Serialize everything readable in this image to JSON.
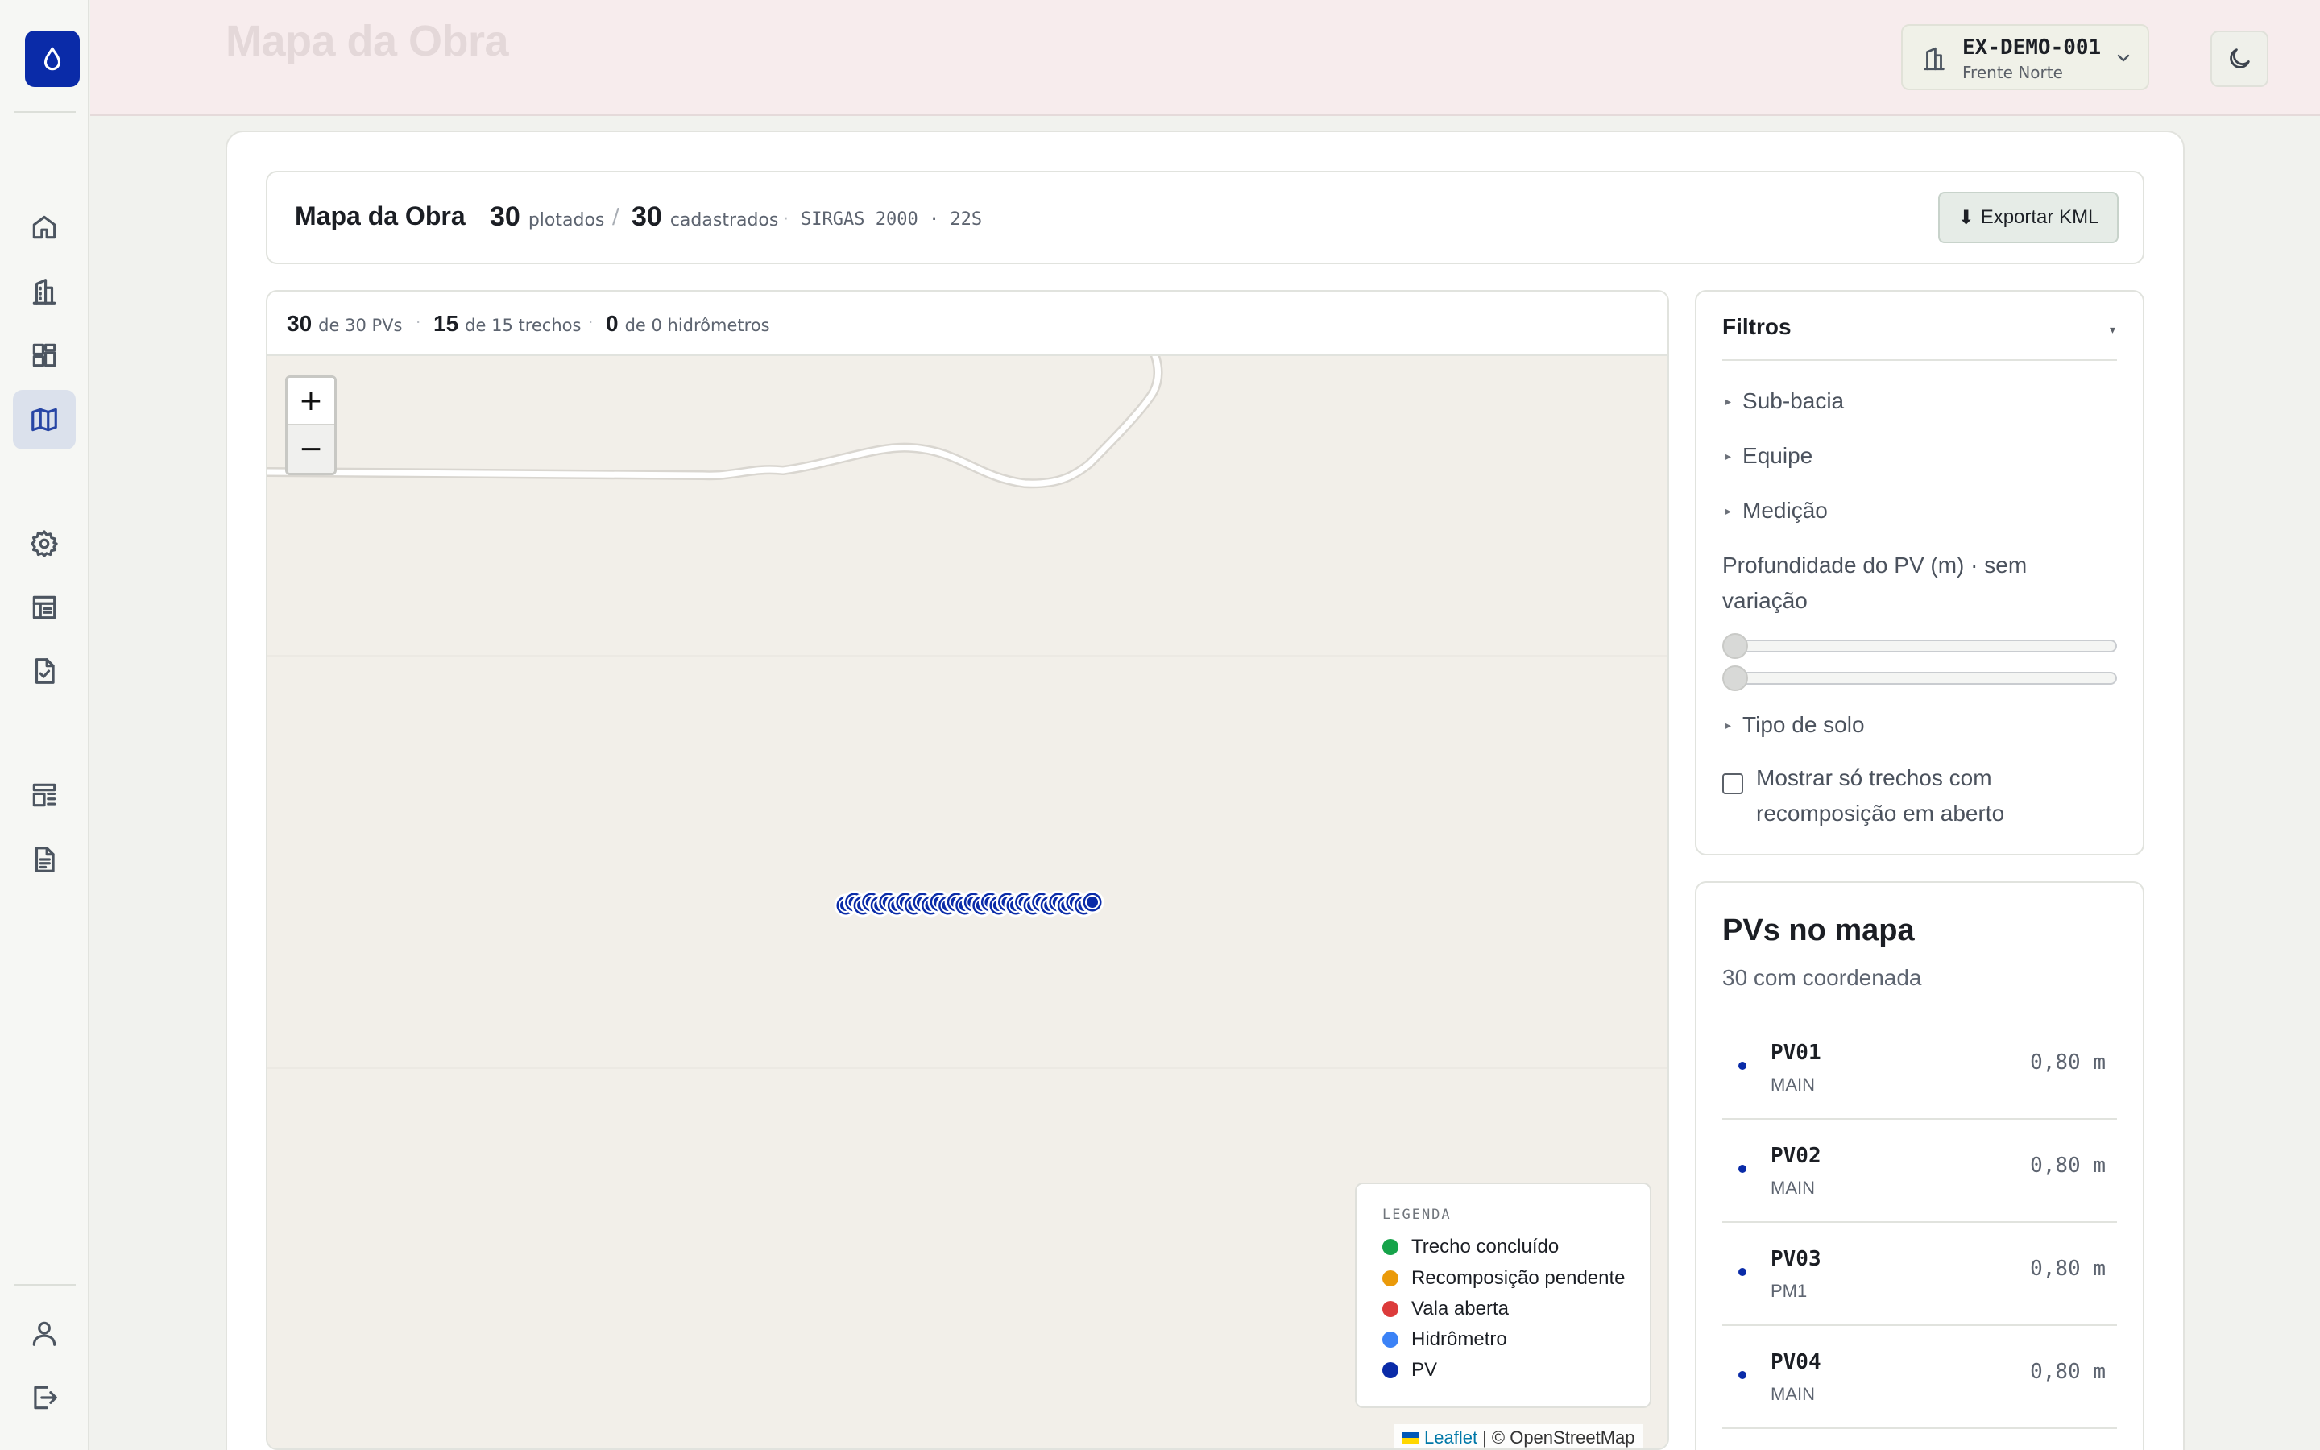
{
  "header": {
    "page_title": "Mapa da Obra",
    "project_code": "EX-DEMO-001",
    "project_front": "Frente Norte"
  },
  "sidebar": {
    "items": [
      {
        "name": "home",
        "icon": "home-icon"
      },
      {
        "name": "obras",
        "icon": "building-icon"
      },
      {
        "name": "dashboard",
        "icon": "dashboard-icon"
      },
      {
        "name": "mapa",
        "icon": "map-icon",
        "active": true
      },
      {
        "name": "configuracoes",
        "icon": "gear-icon"
      },
      {
        "name": "tabelas",
        "icon": "table-icon"
      },
      {
        "name": "checklist",
        "icon": "file-check-icon"
      },
      {
        "name": "layout",
        "icon": "layout-icon"
      },
      {
        "name": "documentos",
        "icon": "document-icon"
      },
      {
        "name": "perfil",
        "icon": "user-icon"
      },
      {
        "name": "sair",
        "icon": "logout-icon"
      }
    ]
  },
  "summary": {
    "title": "Mapa da Obra",
    "plotted_count": "30",
    "plotted_label": "plotados",
    "separator": "/",
    "registered_count": "30",
    "registered_label": "cadastrados",
    "crs": "SIRGAS 2000 · 22S",
    "export_label": "Exportar KML"
  },
  "map_stats": {
    "pvs_count": "30",
    "pvs_label": "de 30 PVs",
    "trechos_count": "15",
    "trechos_label": "de 15 trechos",
    "hidro_count": "0",
    "hidro_label": "de 0 hidrômetros"
  },
  "map": {
    "zoom_in": "+",
    "zoom_out": "−",
    "pv_marker_count": 30,
    "pv_color": "#0a2ba8",
    "attribution_leaflet": "Leaflet",
    "attribution_osm": "| © OpenStreetMap"
  },
  "legend": {
    "title": "LEGENDA",
    "items": [
      {
        "label": "Trecho concluído",
        "color": "#16a34a"
      },
      {
        "label": "Recomposição pendente",
        "color": "#ea9a0a"
      },
      {
        "label": "Vala aberta",
        "color": "#dc3b3b"
      },
      {
        "label": "Hidrômetro",
        "color": "#3b82f6"
      },
      {
        "label": "PV",
        "color": "#0a2ba8"
      }
    ]
  },
  "filters": {
    "title": "Filtros",
    "caret": "▾",
    "groups": [
      "Sub-bacia",
      "Equipe",
      "Medição"
    ],
    "depth_label": "Profundidade do PV (m) · sem variação",
    "soil_label": "Tipo de solo",
    "checkbox_label": "Mostrar só trechos com recomposição em aberto"
  },
  "pv_list": {
    "title": "PVs no mapa",
    "subtitle": "30 com coordenada",
    "rows": [
      {
        "name": "PV01",
        "group": "MAIN",
        "depth": "0,80 m"
      },
      {
        "name": "PV02",
        "group": "MAIN",
        "depth": "0,80 m"
      },
      {
        "name": "PV03",
        "group": "PM1",
        "depth": "0,80 m"
      },
      {
        "name": "PV04",
        "group": "MAIN",
        "depth": "0,80 m"
      }
    ]
  }
}
